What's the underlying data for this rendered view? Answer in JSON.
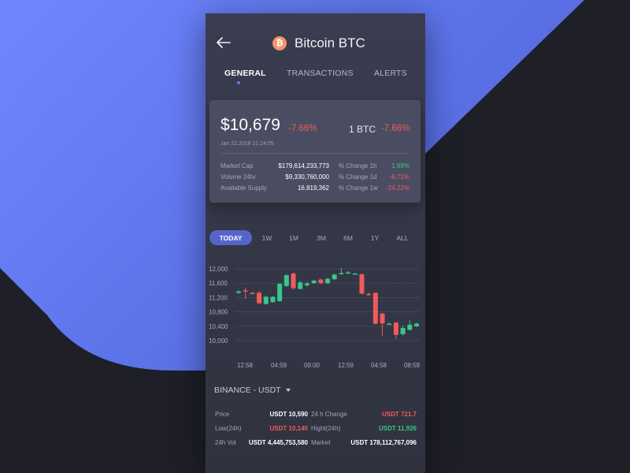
{
  "header": {
    "title": "Bitcoin BTC",
    "coin_symbol": "₿",
    "back_icon": "arrow-left-icon"
  },
  "tabs": [
    {
      "label": "GENERAL",
      "active": true
    },
    {
      "label": "TRANSACTIONS",
      "active": false
    },
    {
      "label": "ALERTS",
      "active": false
    }
  ],
  "summary": {
    "price": "$10,679",
    "price_change": "-7.66%",
    "unit": "1 BTC",
    "unit_change": "-7.66%",
    "timestamp": "Jan 22.2018 21:24:05",
    "stats": [
      {
        "label": "Market Cap",
        "value": "$179,614,233,773",
        "label2": "% Change 1h",
        "value2": "1.69%",
        "trend2": "up"
      },
      {
        "label": "Volume 24hr",
        "value": "$9,330,760,000",
        "label2": "% Change 1d",
        "value2": "-6.72%",
        "trend2": "down"
      },
      {
        "label": "Available Supply",
        "value": "16,819,362",
        "label2": "% Change 1w",
        "value2": "-24.22%",
        "trend2": "down"
      }
    ]
  },
  "ranges": [
    "TODAY",
    "1W",
    "1M",
    "3M",
    "6M",
    "1Y",
    "ALL"
  ],
  "active_range": "TODAY",
  "chart_data": {
    "type": "candlestick",
    "y_ticks": [
      "12,000",
      "11,600",
      "11,200",
      "10,800",
      "10,400",
      "10,000"
    ],
    "ylim": [
      9900,
      12200
    ],
    "x_ticks": [
      "12:58",
      "04:59",
      "09:00",
      "12:59",
      "04:58",
      "08:59"
    ],
    "colors": {
      "up": "#35c88a",
      "down": "#f05b5b"
    },
    "candles": [
      {
        "o": 11330,
        "c": 11370,
        "h": 11400,
        "l": 11300
      },
      {
        "o": 11400,
        "c": 11380,
        "h": 11480,
        "l": 11160
      },
      {
        "o": 11330,
        "c": 11310,
        "h": 11360,
        "l": 11290
      },
      {
        "o": 11330,
        "c": 11040,
        "h": 11380,
        "l": 11020
      },
      {
        "o": 11020,
        "c": 11220,
        "h": 11260,
        "l": 11000
      },
      {
        "o": 11070,
        "c": 11220,
        "h": 11240,
        "l": 11060
      },
      {
        "o": 11100,
        "c": 11580,
        "h": 11600,
        "l": 11080
      },
      {
        "o": 11520,
        "c": 11820,
        "h": 11850,
        "l": 11500
      },
      {
        "o": 11870,
        "c": 11460,
        "h": 11900,
        "l": 11420
      },
      {
        "o": 11440,
        "c": 11620,
        "h": 11660,
        "l": 11420
      },
      {
        "o": 11540,
        "c": 11590,
        "h": 11640,
        "l": 11500
      },
      {
        "o": 11600,
        "c": 11670,
        "h": 11700,
        "l": 11580
      },
      {
        "o": 11700,
        "c": 11600,
        "h": 11730,
        "l": 11570
      },
      {
        "o": 11600,
        "c": 11720,
        "h": 11750,
        "l": 11580
      },
      {
        "o": 11710,
        "c": 11840,
        "h": 11860,
        "l": 11690
      },
      {
        "o": 11850,
        "c": 11880,
        "h": 12020,
        "l": 11840
      },
      {
        "o": 11880,
        "c": 11900,
        "h": 11940,
        "l": 11860
      },
      {
        "o": 11860,
        "c": 11870,
        "h": 11880,
        "l": 11840
      },
      {
        "o": 11850,
        "c": 11310,
        "h": 11860,
        "l": 11280
      },
      {
        "o": 11300,
        "c": 11270,
        "h": 11340,
        "l": 11250
      },
      {
        "o": 11330,
        "c": 10470,
        "h": 11340,
        "l": 10450
      },
      {
        "o": 10750,
        "c": 10480,
        "h": 10780,
        "l": 10140
      },
      {
        "o": 10460,
        "c": 10470,
        "h": 10500,
        "l": 10440
      },
      {
        "o": 10500,
        "c": 10160,
        "h": 10520,
        "l": 10040
      },
      {
        "o": 10180,
        "c": 10350,
        "h": 10420,
        "l": 10140
      },
      {
        "o": 10300,
        "c": 10440,
        "h": 10560,
        "l": 10280
      },
      {
        "o": 10400,
        "c": 10470,
        "h": 10500,
        "l": 10380
      }
    ]
  },
  "market": {
    "selector": "BINANCE - USDT",
    "rows": [
      {
        "label": "Price",
        "value": "USDT 10,590",
        "value_trend": "neutral",
        "label2": "24 h Change",
        "value2": "USDT 721.7",
        "trend2": "down"
      },
      {
        "label": "Low(24h)",
        "value": "USDT 10,140",
        "value_trend": "down",
        "label2": "Hight(24h)",
        "value2": "USDT 11,926",
        "trend2": "up"
      },
      {
        "label": "24h Vol",
        "value": "USDT 4,445,753,580",
        "value_trend": "neutral",
        "label2": "Market",
        "value2": "USDT 178,112,767,096",
        "trend2": "neutral"
      }
    ]
  },
  "colors": {
    "accent": "#5765c8",
    "background_blue": "#6a7ef5",
    "background_dark": "#1e1f27",
    "up": "#35c88a",
    "down": "#f05b5b"
  }
}
